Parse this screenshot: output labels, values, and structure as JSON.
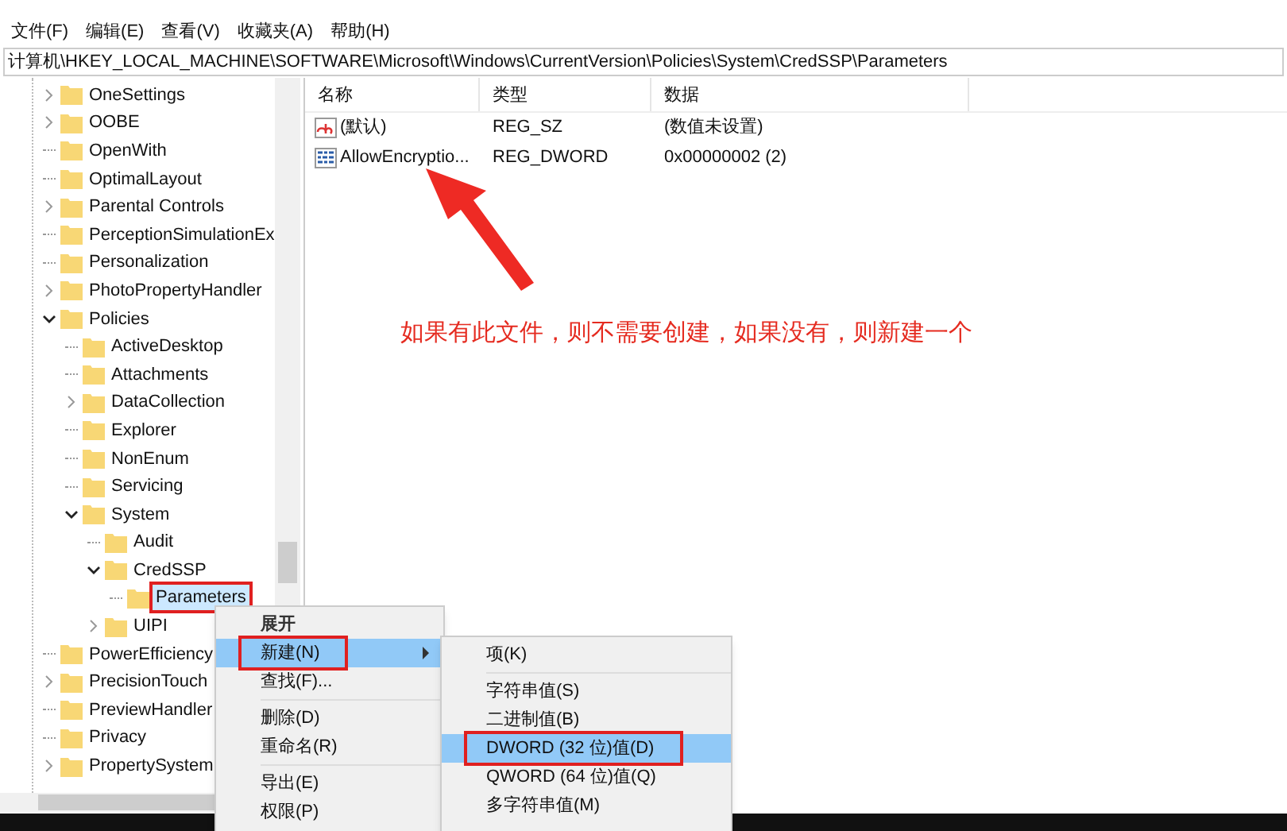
{
  "menu_bar": [
    "文件(F)",
    "编辑(E)",
    "查看(V)",
    "收藏夹(A)",
    "帮助(H)"
  ],
  "address": "计算机\\HKEY_LOCAL_MACHINE\\SOFTWARE\\Microsoft\\Windows\\CurrentVersion\\Policies\\System\\CredSSP\\Parameters",
  "tree": [
    {
      "label": "OneSettings",
      "expanded": false,
      "selected": false
    },
    {
      "label": "OOBE",
      "expanded": false,
      "selected": false
    },
    {
      "label": "OpenWith",
      "selected": false
    },
    {
      "label": "OptimalLayout",
      "selected": false
    },
    {
      "label": "Parental Controls",
      "expanded": false,
      "selected": false
    },
    {
      "label": "PerceptionSimulationEx",
      "selected": false
    },
    {
      "label": "Personalization",
      "selected": false
    },
    {
      "label": "PhotoPropertyHandler",
      "expanded": false,
      "selected": false
    },
    {
      "label": "Policies",
      "expanded": true,
      "selected": false,
      "children": [
        {
          "label": "ActiveDesktop",
          "selected": false
        },
        {
          "label": "Attachments",
          "selected": false
        },
        {
          "label": "DataCollection",
          "expanded": false,
          "selected": false
        },
        {
          "label": "Explorer",
          "selected": false
        },
        {
          "label": "NonEnum",
          "selected": false
        },
        {
          "label": "Servicing",
          "selected": false
        },
        {
          "label": "System",
          "expanded": true,
          "selected": false,
          "children": [
            {
              "label": "Audit",
              "selected": false
            },
            {
              "label": "CredSSP",
              "expanded": true,
              "selected": false,
              "children": [
                {
                  "label": "Parameters",
                  "selected": true
                }
              ]
            },
            {
              "label": "UIPI",
              "expanded": false,
              "selected": false
            }
          ]
        }
      ]
    },
    {
      "label": "PowerEfficiency",
      "selected": false
    },
    {
      "label": "PrecisionTouch",
      "expanded": false,
      "selected": false
    },
    {
      "label": "PreviewHandler",
      "selected": false
    },
    {
      "label": "Privacy",
      "selected": false
    },
    {
      "label": "PropertySystem",
      "expanded": false,
      "selected": false
    }
  ],
  "list": {
    "columns": [
      "名称",
      "类型",
      "数据"
    ],
    "rows": [
      {
        "kind": "string",
        "name": "(默认)",
        "type": "REG_SZ",
        "data": "(数值未设置)"
      },
      {
        "kind": "binary",
        "name": "AllowEncryptio...",
        "type": "REG_DWORD",
        "data": "0x00000002 (2)"
      }
    ]
  },
  "annotation": "如果有此文件，则不需要创建，如果没有，则新建一个",
  "context_menu": [
    {
      "kind": "item",
      "label": "展开",
      "default": true,
      "selected": false
    },
    {
      "kind": "item",
      "label": "新建(N)",
      "selected": true,
      "submenu": true
    },
    {
      "kind": "item",
      "label": "查找(F)...",
      "selected": false
    },
    {
      "kind": "separator"
    },
    {
      "kind": "item",
      "label": "删除(D)",
      "selected": false
    },
    {
      "kind": "item",
      "label": "重命名(R)",
      "selected": false
    },
    {
      "kind": "separator"
    },
    {
      "kind": "item",
      "label": "导出(E)",
      "selected": false
    },
    {
      "kind": "item",
      "label": "权限(P)",
      "selected": false
    }
  ],
  "submenu": [
    {
      "kind": "item",
      "label": "项(K)",
      "selected": false
    },
    {
      "kind": "separator"
    },
    {
      "kind": "item",
      "label": "字符串值(S)",
      "selected": false
    },
    {
      "kind": "item",
      "label": "二进制值(B)",
      "selected": false
    },
    {
      "kind": "item",
      "label": "DWORD (32 位)值(D)",
      "selected": true
    },
    {
      "kind": "item",
      "label": "QWORD (64 位)值(Q)",
      "selected": false
    },
    {
      "kind": "item",
      "label": "多字符串值(M)",
      "selected": false
    }
  ]
}
